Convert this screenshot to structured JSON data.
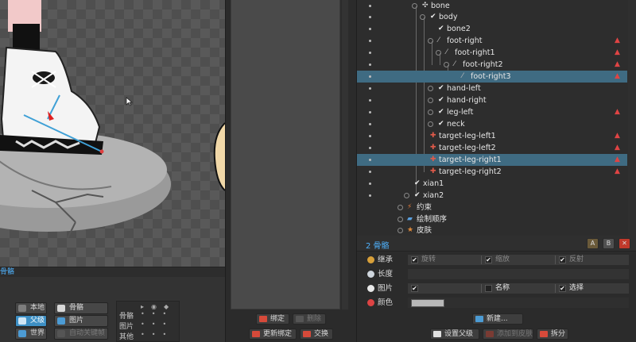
{
  "viewport": {
    "section_label": "骨骼",
    "axes": {
      "local": "本地",
      "parent": "父级",
      "world": "世界"
    },
    "show": {
      "bones": "骨骼",
      "images": "图片",
      "auto_key": "自动关键帧"
    },
    "visibility": {
      "bones": "骨骼",
      "images": "图片",
      "others": "其他"
    }
  },
  "middle": {
    "bind": "绑定",
    "remove": "删除",
    "update_bind": "更新绑定",
    "swap": "交换"
  },
  "tree": {
    "nodes": [
      {
        "label": "bone",
        "icon": "bone-root-icon",
        "selected": false,
        "keyed": false
      },
      {
        "label": "body",
        "icon": "bone-icon",
        "selected": false,
        "keyed": false
      },
      {
        "label": "bone2",
        "icon": "bone-icon",
        "selected": false,
        "keyed": false
      },
      {
        "label": "foot-right",
        "icon": "bone-icon",
        "selected": false,
        "keyed": true
      },
      {
        "label": "foot-right1",
        "icon": "bone-icon",
        "selected": false,
        "keyed": true
      },
      {
        "label": "foot-right2",
        "icon": "bone-icon",
        "selected": false,
        "keyed": true
      },
      {
        "label": "foot-right3",
        "icon": "bone-icon",
        "selected": true,
        "keyed": true
      },
      {
        "label": "hand-left",
        "icon": "bone-icon",
        "selected": false,
        "keyed": false
      },
      {
        "label": "hand-right",
        "icon": "bone-icon",
        "selected": false,
        "keyed": false
      },
      {
        "label": "leg-left",
        "icon": "bone-icon",
        "selected": false,
        "keyed": true
      },
      {
        "label": "neck",
        "icon": "bone-icon",
        "selected": false,
        "keyed": false
      },
      {
        "label": "target-leg-left1",
        "icon": "target-bone-icon",
        "selected": false,
        "keyed": true
      },
      {
        "label": "target-leg-left2",
        "icon": "target-bone-icon",
        "selected": false,
        "keyed": true
      },
      {
        "label": "target-leg-right1",
        "icon": "target-bone-icon",
        "selected": true,
        "keyed": true
      },
      {
        "label": "target-leg-right2",
        "icon": "target-bone-icon",
        "selected": false,
        "keyed": true
      },
      {
        "label": "xian1",
        "icon": "bone-icon",
        "selected": false,
        "keyed": false
      },
      {
        "label": "xian2",
        "icon": "bone-icon",
        "selected": false,
        "keyed": false
      },
      {
        "label": "约束",
        "icon": "constraint-icon",
        "selected": false,
        "keyed": false
      },
      {
        "label": "绘制顺序",
        "icon": "draw-order-icon",
        "selected": false,
        "keyed": false
      },
      {
        "label": "皮肤",
        "icon": "skin-icon",
        "selected": false,
        "keyed": false
      }
    ]
  },
  "properties": {
    "title": "2 骨骼",
    "header_buttons": [
      "A",
      "B"
    ],
    "inherit": {
      "label": "继承",
      "rotation": "旋转",
      "scale": "缩放",
      "reflect": "反射"
    },
    "length": {
      "label": "长度"
    },
    "image": {
      "label": "图片",
      "name": "名称",
      "select": "选择"
    },
    "color": {
      "label": "颜色",
      "value": "#b8b8b8"
    },
    "new_button": "新建...",
    "set_parent": "设置父级",
    "add_to_skin": "添加到皮肤",
    "split": "拆分"
  }
}
